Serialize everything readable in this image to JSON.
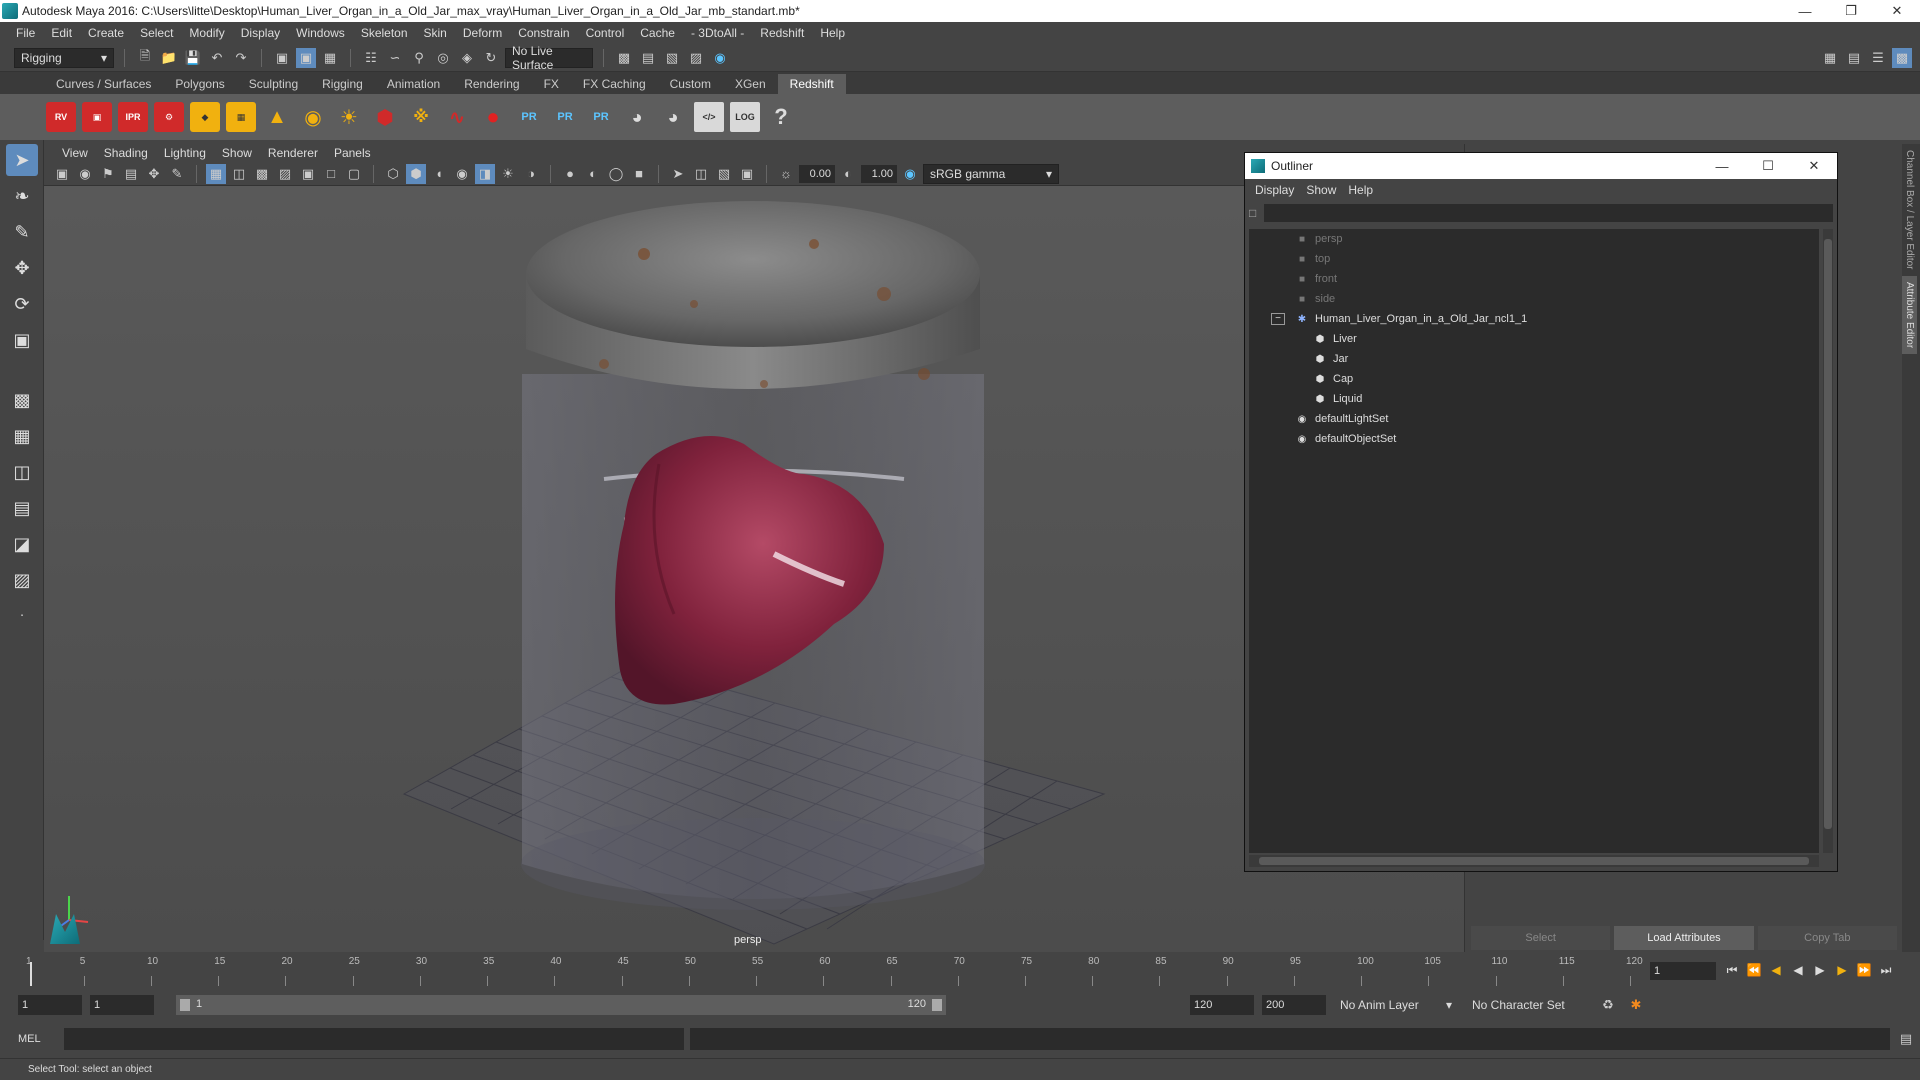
{
  "window": {
    "title": "Autodesk Maya 2016: C:\\Users\\litte\\Desktop\\Human_Liver_Organ_in_a_Old_Jar_max_vray\\Human_Liver_Organ_in_a_Old_Jar_mb_standart.mb*"
  },
  "menubar": [
    "File",
    "Edit",
    "Create",
    "Select",
    "Modify",
    "Display",
    "Windows",
    "Skeleton",
    "Skin",
    "Deform",
    "Constrain",
    "Control",
    "Cache",
    "- 3DtoAll -",
    "Redshift",
    "Help"
  ],
  "statusline": {
    "mode": "Rigging",
    "live_surface": "No Live Surface"
  },
  "shelf_tabs": [
    {
      "label": "Curves / Surfaces",
      "active": false
    },
    {
      "label": "Polygons",
      "active": false
    },
    {
      "label": "Sculpting",
      "active": false
    },
    {
      "label": "Rigging",
      "active": false
    },
    {
      "label": "Animation",
      "active": false
    },
    {
      "label": "Rendering",
      "active": false
    },
    {
      "label": "FX",
      "active": false
    },
    {
      "label": "FX Caching",
      "active": false
    },
    {
      "label": "Custom",
      "active": false
    },
    {
      "label": "XGen",
      "active": false
    },
    {
      "label": "Redshift",
      "active": true
    }
  ],
  "shelf_labels": {
    "rv": "RV",
    "ipr": "IPR",
    "pr": "PR",
    "log": "LOG",
    "help": "?"
  },
  "viewport": {
    "menu": [
      "View",
      "Shading",
      "Lighting",
      "Show",
      "Renderer",
      "Panels"
    ],
    "exposure": "0.00",
    "gamma": "1.00",
    "color_space": "sRGB gamma",
    "camera": "persp"
  },
  "outliner": {
    "title": "Outliner",
    "menu": [
      "Display",
      "Show",
      "Help"
    ],
    "nodes": [
      {
        "label": "persp",
        "icon": "camera-icon"
      },
      {
        "label": "top",
        "icon": "camera-icon"
      },
      {
        "label": "front",
        "icon": "camera-icon"
      },
      {
        "label": "side",
        "icon": "camera-icon"
      },
      {
        "label": "Human_Liver_Organ_in_a_Old_Jar_ncl1_1",
        "icon": "group-icon"
      },
      {
        "label": "Liver",
        "icon": "mesh-icon"
      },
      {
        "label": "Jar",
        "icon": "mesh-icon"
      },
      {
        "label": "Cap",
        "icon": "mesh-icon"
      },
      {
        "label": "Liquid",
        "icon": "mesh-icon"
      },
      {
        "label": "defaultLightSet",
        "icon": "set-icon"
      },
      {
        "label": "defaultObjectSet",
        "icon": "set-icon"
      }
    ]
  },
  "attribute_editor": {
    "select": "Select",
    "load": "Load Attributes",
    "copy": "Copy Tab"
  },
  "side_tabs": [
    "Channel Box / Layer Editor",
    "Attribute Editor"
  ],
  "timeline": {
    "ticks": [
      "1",
      "5",
      "10",
      "15",
      "20",
      "25",
      "30",
      "35",
      "40",
      "45",
      "50",
      "55",
      "60",
      "65",
      "70",
      "75",
      "80",
      "85",
      "90",
      "95",
      "100",
      "105",
      "110",
      "115",
      "120"
    ],
    "current_frame": "1"
  },
  "range": {
    "start": "1",
    "playback_start": "1",
    "bar_start": "1",
    "bar_end": "120",
    "playback_end": "120",
    "end": "200",
    "anim_layer": "No Anim Layer",
    "character_set": "No Character Set"
  },
  "cmdline": {
    "lang": "MEL"
  },
  "helpline": {
    "text": "Select Tool: select an object"
  }
}
